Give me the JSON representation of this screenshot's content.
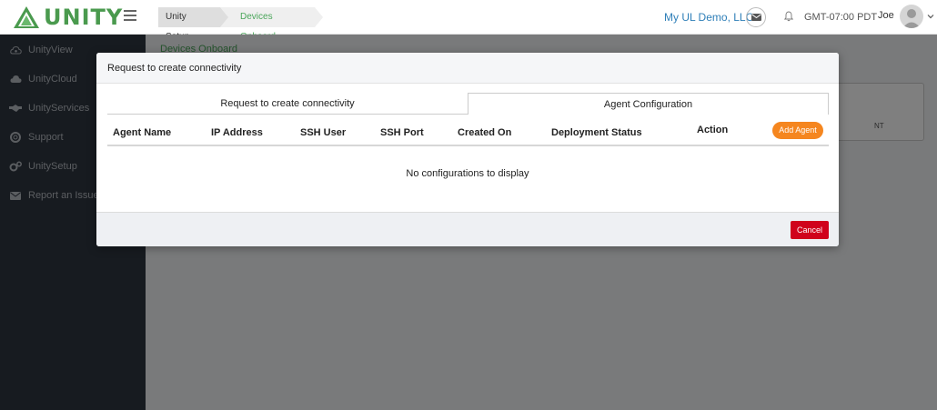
{
  "header": {
    "brand": "UNITY",
    "breadcrumbs": [
      "Unity Setup",
      "Devices Onboard"
    ],
    "company": "My UL Demo, LLC",
    "timezone": "GMT-07:00 PDT",
    "user": "Joe",
    "icons": {
      "menu": "hamburger-icon",
      "mail": "envelope-icon",
      "notifications": "bell-icon",
      "account": "chevron-down-icon"
    }
  },
  "sidebar": {
    "items": [
      {
        "label": "UnityView",
        "icon": "cloud-eye-icon"
      },
      {
        "label": "UnityCloud",
        "icon": "cloud-icon"
      },
      {
        "label": "UnityServices",
        "icon": "handshake-icon"
      },
      {
        "label": "Support",
        "icon": "lifebuoy-icon"
      },
      {
        "label": "UnitySetup",
        "icon": "gears-icon"
      },
      {
        "label": "Report an Issue",
        "icon": "envelope-icon"
      }
    ]
  },
  "main": {
    "breadcrumb": "Devices Onboard",
    "card_fragment": "NT"
  },
  "modal": {
    "title": "Request to create connectivity",
    "tabs": [
      {
        "label": "Request to create connectivity",
        "active": false
      },
      {
        "label": "Agent Configuration",
        "active": true
      }
    ],
    "columns": [
      "Agent Name",
      "IP Address",
      "SSH User",
      "SSH Port",
      "Created On",
      "Deployment Status",
      "Action"
    ],
    "add_agent_label": "Add Agent",
    "empty_message": "No configurations to display",
    "cancel_label": "Cancel"
  },
  "colors": {
    "brand_green": "#4a9a4e",
    "link_blue": "#2f7fb8",
    "sidebar_bg": "#2f3640",
    "add_button": "#f5861f",
    "cancel_button": "#d0021b"
  }
}
